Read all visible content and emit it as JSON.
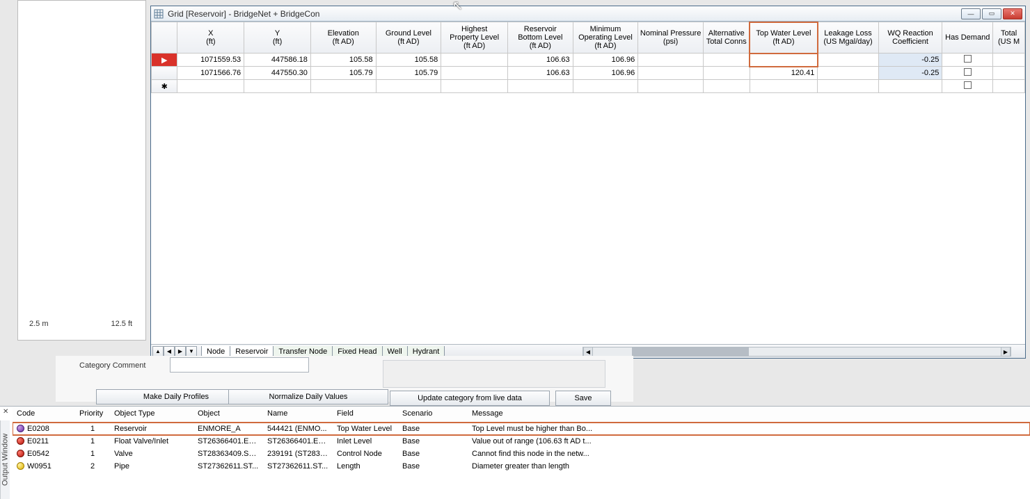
{
  "window": {
    "title": "Grid [Reservoir] - BridgeNet + BridgeCon"
  },
  "scale": {
    "left": "2.5 m",
    "right": "12.5 ft"
  },
  "columns": {
    "x": "X\n(ft)",
    "y": "Y\n(ft)",
    "elev": "Elevation\n(ft AD)",
    "gl": "Ground Level\n(ft AD)",
    "hpl": "Highest\nProperty Level\n(ft AD)",
    "rbl": "Reservoir\nBottom Level\n(ft AD)",
    "mol": "Minimum\nOperating Level\n(ft AD)",
    "np": "Nominal Pressure\n(psi)",
    "atc": "Alternative\nTotal Conns",
    "twl": "Top Water Level\n(ft AD)",
    "ll": "Leakage Loss\n(US Mgal/day)",
    "wq": "WQ Reaction\nCoefficient",
    "hd": "Has Demand",
    "tot": "Total\n(US M"
  },
  "rows": [
    {
      "x": "1071559.53",
      "y": "447586.18",
      "elev": "105.58",
      "gl": "105.58",
      "hpl": "",
      "rbl": "106.63",
      "mol": "106.96",
      "np": "",
      "atc": "",
      "twl": "",
      "ll": "",
      "wq": "-0.25",
      "hd": false
    },
    {
      "x": "1071566.76",
      "y": "447550.30",
      "elev": "105.79",
      "gl": "105.79",
      "hpl": "",
      "rbl": "106.63",
      "mol": "106.96",
      "np": "",
      "atc": "",
      "twl": "120.41",
      "ll": "",
      "wq": "-0.25",
      "hd": false
    }
  ],
  "tabs": [
    "Node",
    "Reservoir",
    "Transfer Node",
    "Fixed Head",
    "Well",
    "Hydrant"
  ],
  "mid": {
    "category_comment": "Category Comment",
    "make_daily": "Make Daily Profiles",
    "normalize": "Normalize Daily Values",
    "update": "Update category from live data",
    "save": "Save"
  },
  "output": {
    "label": "Output Window",
    "headers": {
      "code": "Code",
      "priority": "Priority",
      "objtype": "Object Type",
      "object": "Object",
      "name": "Name",
      "field": "Field",
      "scenario": "Scenario",
      "message": "Message"
    },
    "rows": [
      {
        "sev": "purple",
        "code": "E0208",
        "priority": "1",
        "objtype": "Reservoir",
        "object": "ENMORE_A",
        "name": "544421 (ENMO...",
        "field": "Top Water Level",
        "scenario": "Base",
        "message": "Top Level must be higher than Bo...",
        "hl": true
      },
      {
        "sev": "red",
        "code": "E0211",
        "priority": "1",
        "objtype": "Float Valve/Inlet",
        "object": "ST26366401.EN...",
        "name": "ST26366401.EN...",
        "field": "Inlet Level",
        "scenario": "Base",
        "message": "Value out of range (106.63 ft AD t...",
        "hl": false
      },
      {
        "sev": "red",
        "code": "E0542",
        "priority": "1",
        "objtype": "Valve",
        "object": "ST28363409.ST...",
        "name": "239191 (ST2836...",
        "field": "Control Node",
        "scenario": "Base",
        "message": "Cannot find this node in the netw...",
        "hl": false
      },
      {
        "sev": "yellow",
        "code": "W0951",
        "priority": "2",
        "objtype": "Pipe",
        "object": "ST27362611.ST...",
        "name": "ST27362611.ST...",
        "field": "Length",
        "scenario": "Base",
        "message": "Diameter greater than length",
        "hl": false
      }
    ]
  }
}
